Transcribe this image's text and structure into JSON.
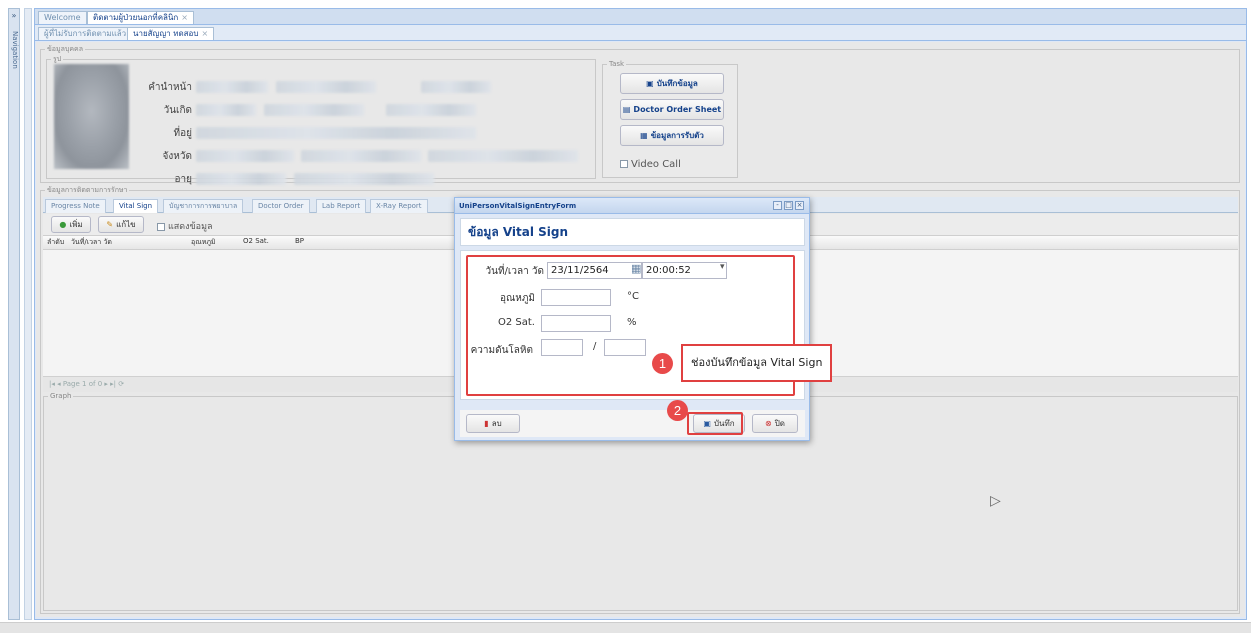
{
  "nav": {
    "toggle": "»",
    "label": "Navigation"
  },
  "top_tabs": [
    {
      "label": "Welcome"
    },
    {
      "label": "ติดตามผู้ป่วยนอกที่คลินิก"
    }
  ],
  "sub_tabs": [
    {
      "label": "ผู้ที่ไม่รับการติดตามแล้ว"
    },
    {
      "label": "นายสัญญา ทดสอบ"
    }
  ],
  "close_glyph": "×",
  "patient": {
    "legend": "ข้อมูลบุคคล",
    "photo_legend": "รูป",
    "fields": {
      "prefix": "คำนำหน้า",
      "birthdate": "วันเกิด",
      "address": "ที่อยู่",
      "province": "จังหวัด",
      "age": "อายุ"
    }
  },
  "task": {
    "legend": "Task",
    "buttons": [
      {
        "label": "บันทึกข้อมูล",
        "icon": "save-icon"
      },
      {
        "label": "Doctor Order Sheet",
        "icon": "sheet-icon"
      },
      {
        "label": "ข้อมูลการรับตัว",
        "icon": "admit-icon"
      }
    ],
    "video_call": "Video Call"
  },
  "treatment": {
    "legend": "ข้อมูลการติดตามการรักษา",
    "tabs": [
      "Progress Note",
      "Vital Sign",
      "บัญชาการการพยาบาล",
      "Doctor Order",
      "Lab Report",
      "X-Ray Report"
    ],
    "active_tab": "Vital Sign",
    "toolbar": {
      "add": "เพิ่ม",
      "edit": "แก้ไข",
      "show": "แสดงข้อมูล"
    },
    "columns": [
      "ลำดับ",
      "วันที่/เวลา วัด",
      "อุณหภูมิ",
      "O2 Sat.",
      "BP"
    ],
    "pager": {
      "page_label": "Page",
      "page_value": "1",
      "of_label": "of 0"
    },
    "graph_legend": "Graph"
  },
  "dialog": {
    "window_title": "UniPersonVitalSignEntryForm",
    "header": "ข้อมูล Vital Sign",
    "fields": {
      "datetime_label": "วันที่/เวลา วัด",
      "date_value": "23/11/2564",
      "time_value": "20:00:52",
      "temp_label": "อุณหภูมิ",
      "temp_value": "",
      "temp_unit": "°C",
      "o2_label": "O2 Sat.",
      "o2_value": "",
      "o2_unit": "%",
      "bp_label": "ความดันโลหิต",
      "bp_sys": "",
      "bp_sep": "/",
      "bp_dia": ""
    },
    "buttons": {
      "delete": "ลบ",
      "save": "บันทึก",
      "close": "ปิด"
    }
  },
  "annotations": [
    {
      "number": "1",
      "text": "ช่องบันทึกข้อมูล Vital Sign"
    },
    {
      "number": "2"
    }
  ],
  "colors": {
    "accent": "#15428b",
    "highlight": "#e04040",
    "panel": "#dfe8f6"
  }
}
